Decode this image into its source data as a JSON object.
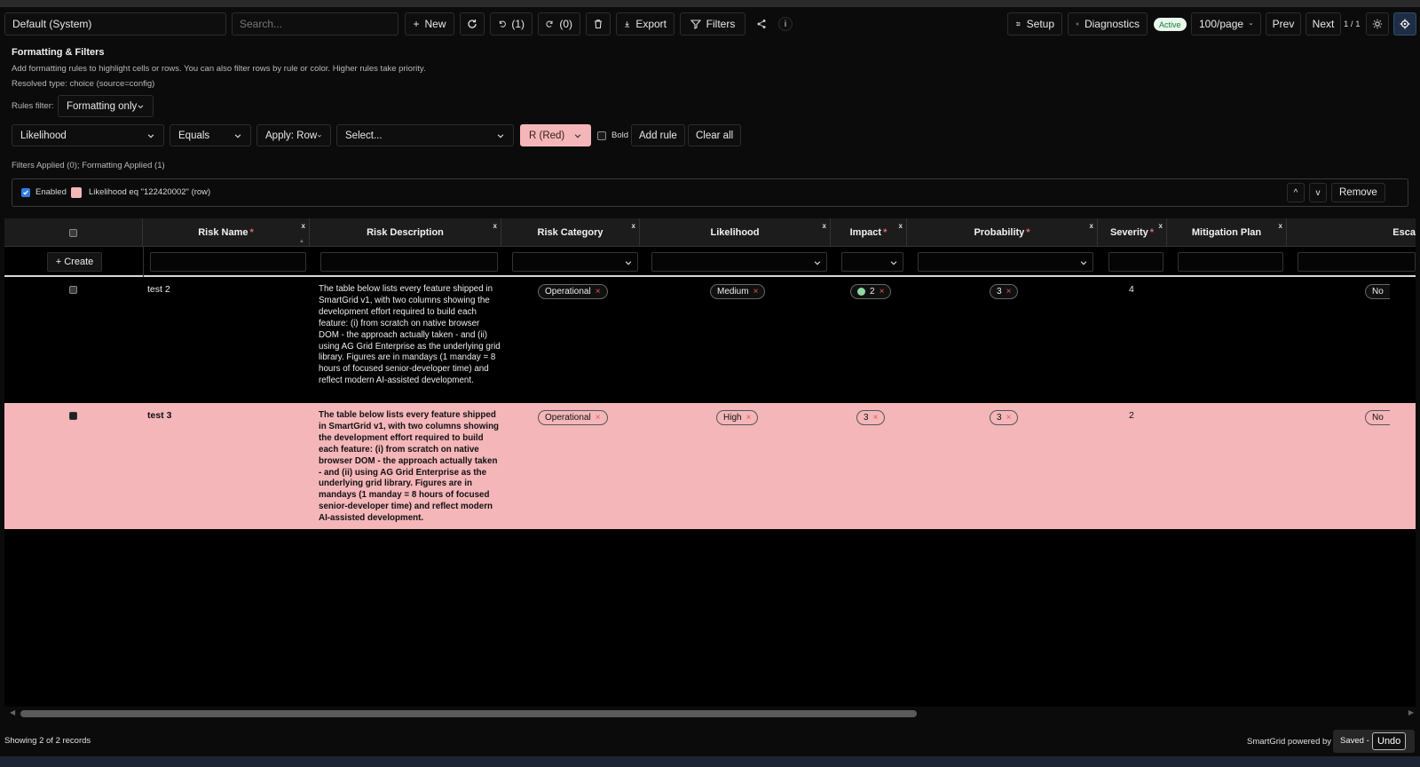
{
  "toolbar": {
    "view_name": "Default (System)",
    "search_placeholder": "Search...",
    "new_label": "New",
    "undo_count": "(1)",
    "redo_count": "(0)",
    "export_label": "Export",
    "filters_label": "Filters",
    "info_label": "i",
    "setup_label": "Setup",
    "diagnostics_label": "Diagnostics",
    "active_badge": "Active",
    "page_size": "100/page",
    "prev_label": "Prev",
    "next_label": "Next",
    "page_indicator": "1 / 1"
  },
  "panel": {
    "title": "Formatting & Filters",
    "subtitle": "Add formatting rules to highlight cells or rows. You can also filter rows by rule or color. Higher rules take priority.",
    "resolved_type": "Resolved type: choice (source=config)",
    "rules_filter_label": "Rules filter:",
    "rules_filter_value": "Formatting only",
    "field_select": "Likelihood",
    "operator_select": "Equals",
    "apply_select": "Apply: Row",
    "value_select": "Select...",
    "color_select": "R (Red)",
    "bold_label": "Bold",
    "add_rule_label": "Add rule",
    "clear_all_label": "Clear all",
    "applied_summary": "Filters Applied (0); Formatting Applied (1)",
    "rule": {
      "enabled_label": "Enabled",
      "enabled": true,
      "text": "Likelihood eq \"122420002\" (row)",
      "up_label": "^",
      "down_label": "v",
      "remove_label": "Remove",
      "color": "#f4b6b9"
    }
  },
  "grid": {
    "columns": [
      {
        "label": "Risk Name",
        "required": "*"
      },
      {
        "label": "Risk Description",
        "required": ""
      },
      {
        "label": "Risk Category",
        "required": ""
      },
      {
        "label": "Likelihood",
        "required": ""
      },
      {
        "label": "Impact",
        "required": "*"
      },
      {
        "label": "Probability",
        "required": "*"
      },
      {
        "label": "Severity",
        "required": "*"
      },
      {
        "label": "Mitigation Plan",
        "required": ""
      },
      {
        "label": "Esca",
        "required": ""
      }
    ],
    "close_glyph": "x",
    "create_label": "+ Create",
    "rows": [
      {
        "name": "test 2",
        "description": "The table below lists every feature shipped in SmartGrid v1, with two columns showing the development effort required to build each feature: (i) from scratch on native browser DOM - the approach actually taken - and (ii) using AG Grid Enterprise as the underlying grid library. Figures are in mandays (1 manday = 8 hours of focused senior-developer time) and reflect modern AI-assisted development.",
        "category": "Operational",
        "likelihood": "Medium",
        "impact": "2",
        "probability": "3",
        "severity": "4",
        "escalation": "No"
      },
      {
        "name": "test 3",
        "description": "The table below lists every feature shipped in SmartGrid v1, with two columns showing the development effort required to build each feature: (i) from scratch on native browser DOM - the approach actually taken - and (ii) using AG Grid Enterprise as the underlying grid library. Figures are in mandays (1 manday = 8 hours of focused senior-developer time) and reflect modern AI-assisted development.",
        "category": "Operational",
        "likelihood": "High",
        "impact": "3",
        "probability": "3",
        "severity": "2",
        "escalation": "No"
      }
    ],
    "pill_remove": "×"
  },
  "footer": {
    "record_count": "Showing 2 of 2 records",
    "powered_by": "SmartGrid powered by",
    "saved_label": "Saved -",
    "undo_label": "Undo"
  },
  "colors": {
    "highlight_row": "#f4b6b9",
    "active_badge_bg": "#e8f7ec",
    "required_mark": "#e06a6a",
    "impact_dot": "#8fd6a4"
  }
}
